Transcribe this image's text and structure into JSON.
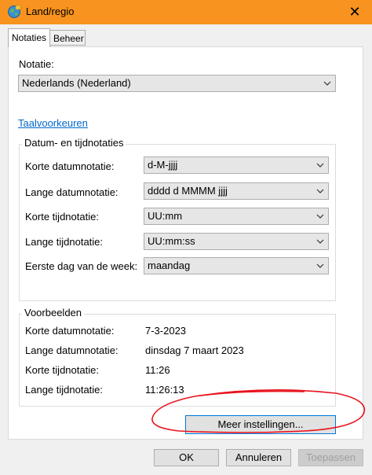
{
  "window": {
    "title": "Land/regio",
    "close_glyph": "✕"
  },
  "tabs": [
    {
      "label": "Notaties"
    },
    {
      "label": "Beheer"
    }
  ],
  "format": {
    "label": "Notatie:",
    "selected": "Nederlands (Nederland)"
  },
  "language_link": "Taalvoorkeuren",
  "datetime_group": {
    "title": "Datum- en tijdnotaties",
    "rows": [
      {
        "label": "Korte datumnotatie:",
        "value": "d-M-jjjj"
      },
      {
        "label": "Lange datumnotatie:",
        "value": "dddd d MMMM jjjj"
      },
      {
        "label": "Korte tijdnotatie:",
        "value": "UU:mm"
      },
      {
        "label": "Lange tijdnotatie:",
        "value": "UU:mm:ss"
      },
      {
        "label": "Eerste dag van de week:",
        "value": "maandag"
      }
    ]
  },
  "examples": {
    "title": "Voorbeelden",
    "rows": [
      {
        "label": "Korte datumnotatie:",
        "value": "7-3-2023"
      },
      {
        "label": "Lange datumnotatie:",
        "value": "dinsdag 7 maart 2023"
      },
      {
        "label": "Korte tijdnotatie:",
        "value": "11:26"
      },
      {
        "label": "Lange tijdnotatie:",
        "value": "11:26:13"
      }
    ]
  },
  "more_settings_label": "Meer instellingen...",
  "footer": {
    "ok": "OK",
    "cancel": "Annuleren",
    "apply": "Toepassen"
  },
  "colors": {
    "titlebar": "#f7931e",
    "annotation": "#e8141e",
    "link": "#0066cc"
  }
}
